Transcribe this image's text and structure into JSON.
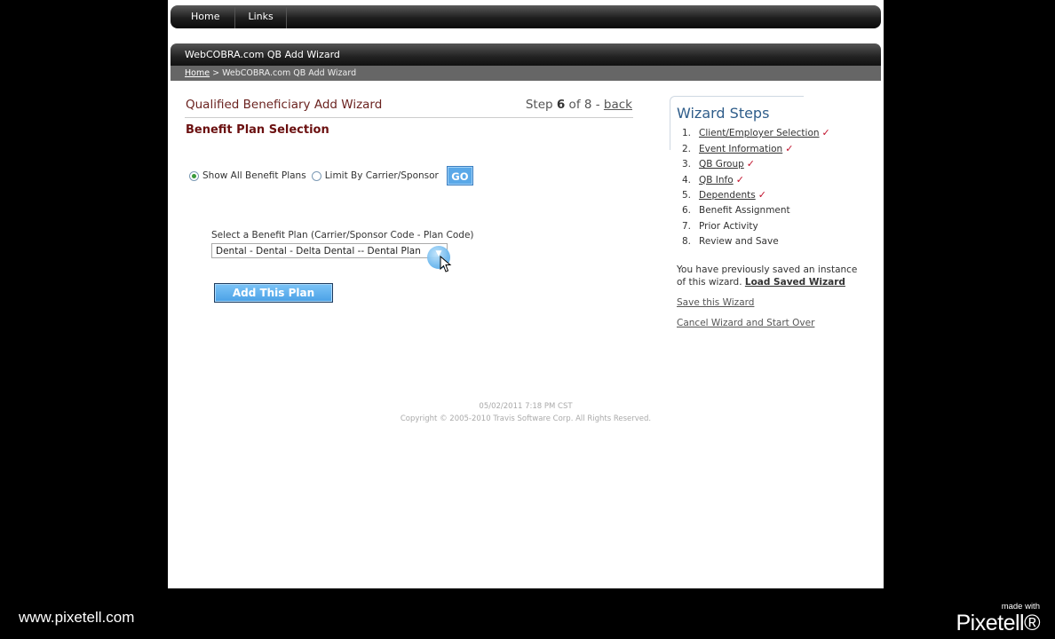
{
  "nav": {
    "items": [
      "Home",
      "Links"
    ]
  },
  "header": {
    "title": "WebCOBRA.com QB Add Wizard",
    "breadcrumb_home": "Home",
    "breadcrumb_sep": " > ",
    "breadcrumb_current": "WebCOBRA.com QB Add Wizard"
  },
  "wizard": {
    "title": "Qualified Beneficiary Add Wizard",
    "step_prefix": "Step ",
    "step_current": "6",
    "step_mid": " of 8 - ",
    "back_label": "back",
    "section_title": "Benefit Plan Selection",
    "radio_all": "Show All Benefit Plans",
    "radio_limit": "Limit By Carrier/Sponsor",
    "go_label": "GO",
    "plan_label": "Select a Benefit Plan (Carrier/Sponsor Code - Plan Code)",
    "plan_selected": "Dental - Dental - Delta Dental -- Dental Plan",
    "add_plan_label": "Add This Plan"
  },
  "sidebar": {
    "title": "Wizard Steps",
    "steps": [
      {
        "num": "1.",
        "label": "Client/Employer Selection",
        "done": true
      },
      {
        "num": "2.",
        "label": "Event Information",
        "done": true
      },
      {
        "num": "3.",
        "label": "QB Group",
        "done": true
      },
      {
        "num": "4.",
        "label": "QB Info",
        "done": true
      },
      {
        "num": "5.",
        "label": "Dependents",
        "done": true
      },
      {
        "num": "6.",
        "label": "Benefit Assignment",
        "done": false
      },
      {
        "num": "7.",
        "label": "Prior Activity",
        "done": false
      },
      {
        "num": "8.",
        "label": "Review and Save",
        "done": false
      }
    ],
    "saved_note": "You have previously saved an instance of this wizard.",
    "load_saved": "Load Saved Wizard",
    "save_link": "Save this Wizard",
    "cancel_link": "Cancel Wizard and Start Over",
    "check_glyph": "✓"
  },
  "footer": {
    "timestamp": "05/02/2011 7:18 PM CST",
    "copyright": "Copyright © 2005-2010 Travis Software Corp. All Rights Reserved."
  },
  "overlay": {
    "url": "www.pixetell.com",
    "made_with": "made with",
    "logo": "Pixetell®"
  }
}
